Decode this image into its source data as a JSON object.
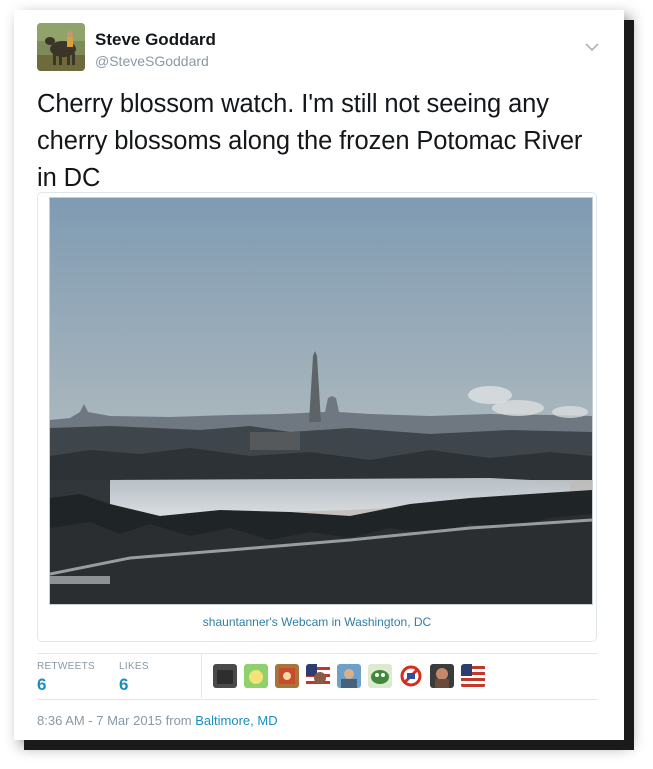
{
  "tweet": {
    "author_name": "Steve Goddard",
    "author_handle": "@SteveSGoddard",
    "text": "Cherry blossom watch. I'm still not seeing any cherry blossoms along the frozen Potomac River in DC",
    "media_caption": "shauntanner's Webcam in Washington, DC"
  },
  "stats": {
    "retweets_label": "RETWEETS",
    "retweets_count": "6",
    "likes_label": "LIKES",
    "likes_count": "6"
  },
  "footer": {
    "time": "8:36 AM - 7 Mar 2015 from ",
    "location": "Baltimore, MD"
  },
  "icons": {
    "more": "chevron-down-icon"
  },
  "colors": {
    "link": "#1b8dbe",
    "muted": "#8899a6",
    "text": "#14171a",
    "border": "#e1e8ed"
  }
}
